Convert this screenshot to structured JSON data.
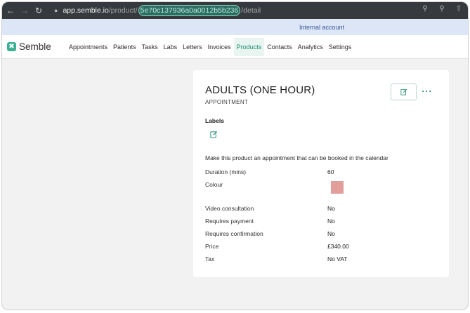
{
  "browser": {
    "back_icon": "arrow-left-icon",
    "forward_icon": "arrow-right-icon",
    "reload_icon": "reload-icon",
    "url_domain": "app.semble.io",
    "url_path_prefix": "/product/",
    "url_highlight": "5e70c137936a0a0012b5b236",
    "url_path_suffix": "/detail",
    "right_icons": [
      "key-icon",
      "zoom-icon",
      "share-icon"
    ]
  },
  "account_strip": {
    "text": "Internal account"
  },
  "header": {
    "logo_text": "Semble",
    "nav": [
      {
        "label": "Appointments",
        "active": false
      },
      {
        "label": "Patients",
        "active": false
      },
      {
        "label": "Tasks",
        "active": false
      },
      {
        "label": "Labs",
        "active": false
      },
      {
        "label": "Letters",
        "active": false
      },
      {
        "label": "Invoices",
        "active": false
      },
      {
        "label": "Products",
        "active": true
      },
      {
        "label": "Contacts",
        "active": false
      },
      {
        "label": "Analytics",
        "active": false
      },
      {
        "label": "Settings",
        "active": false
      }
    ]
  },
  "product": {
    "title": "ADULTS (ONE HOUR)",
    "type": "APPOINTMENT",
    "labels_heading": "Labels",
    "description": "Make this product an appointment that can be booked in the calendar",
    "fields": [
      {
        "label": "Duration (mins)",
        "value": "60"
      },
      {
        "label": "Colour",
        "value": ""
      },
      {
        "label": "Video consultation",
        "value": "No"
      },
      {
        "label": "Requires payment",
        "value": "No"
      },
      {
        "label": "Requires confirmation",
        "value": "No"
      },
      {
        "label": "Price",
        "value": "£340.00"
      },
      {
        "label": "Tax",
        "value": "No VAT"
      }
    ],
    "colour_swatch": "#e29e9b"
  },
  "colors": {
    "brand": "#37b093",
    "active_nav_bg": "#e8f5f1",
    "active_nav_text": "#1e8a70",
    "account_strip_bg": "#dde6f7"
  }
}
